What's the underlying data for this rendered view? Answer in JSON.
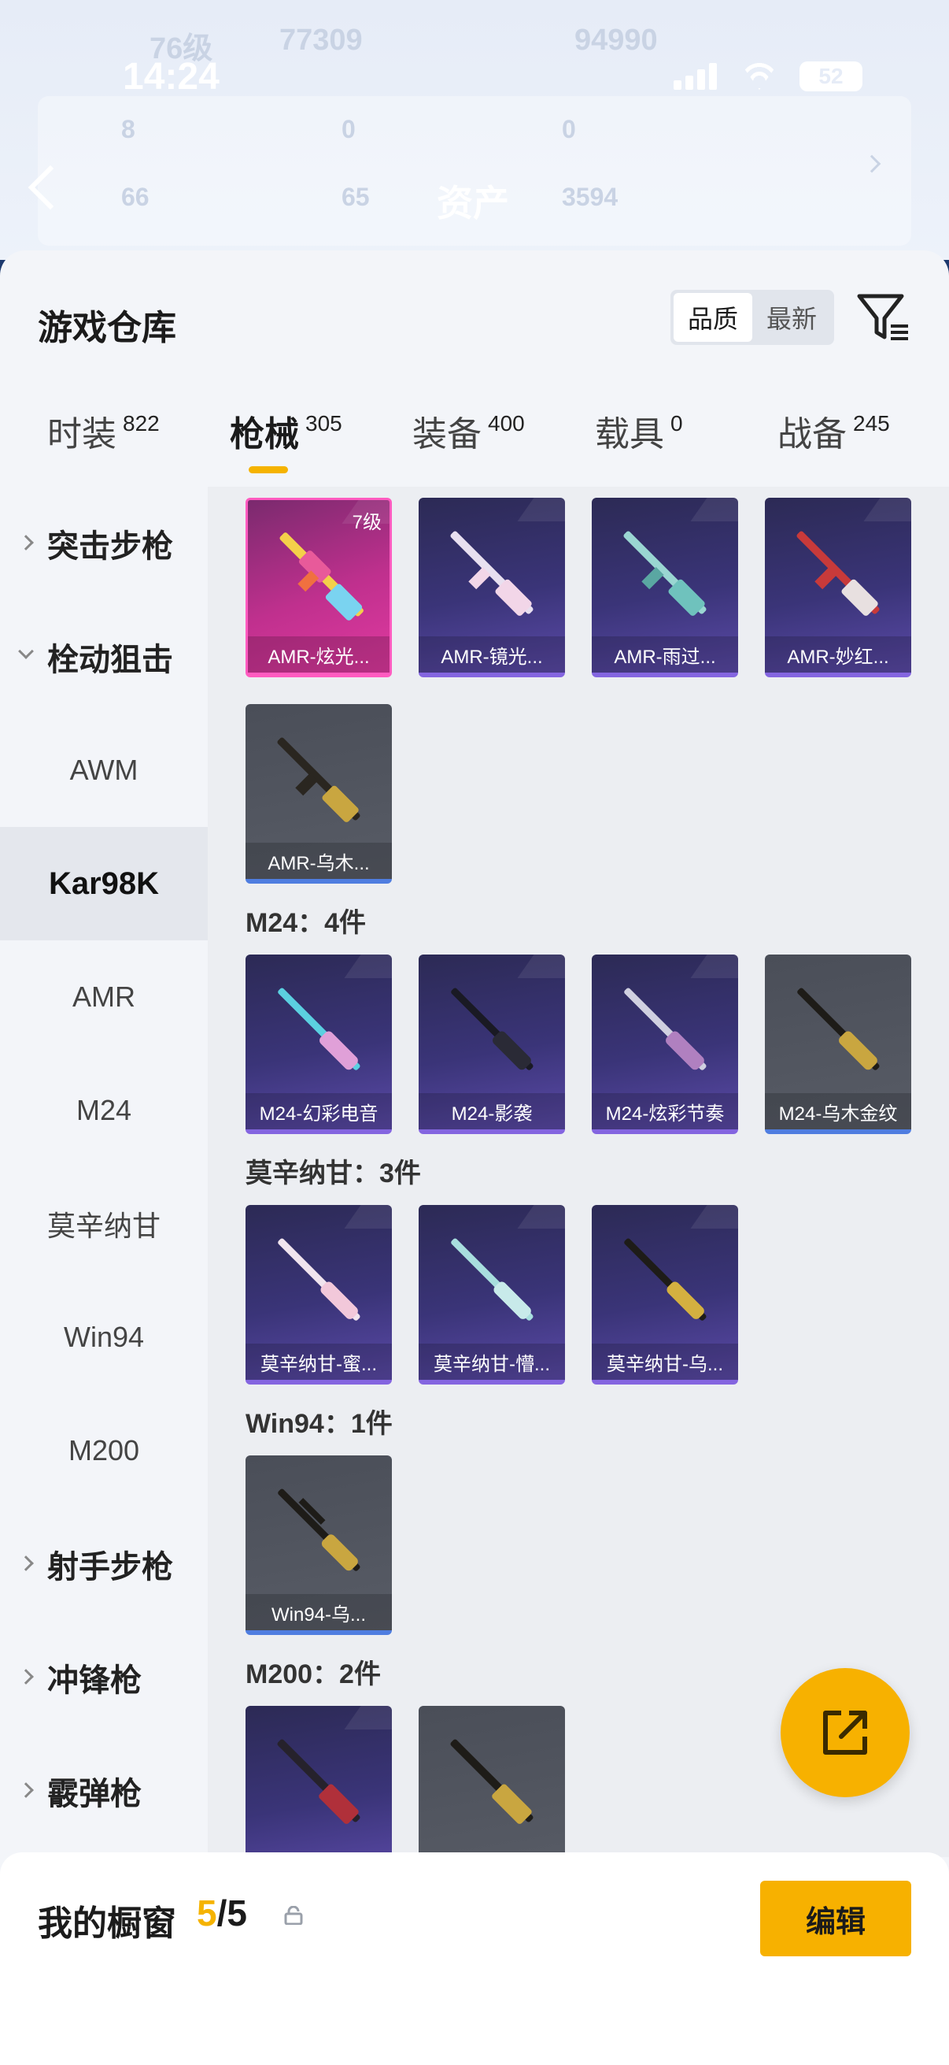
{
  "status_bar": {
    "time": "14:24",
    "battery": "52"
  },
  "background_header": {
    "level": "76级",
    "coins": "77309",
    "points": "94990",
    "stats_row1": [
      "8",
      "0",
      "0"
    ],
    "stats_row2": [
      "66",
      "65",
      "3594"
    ],
    "title": "资产"
  },
  "sheet": {
    "title": "游戏仓库",
    "sort_options": [
      "品质",
      "最新"
    ],
    "active_sort": "品质"
  },
  "tabs": [
    {
      "label": "时装",
      "count": "822"
    },
    {
      "label": "枪械",
      "count": "305"
    },
    {
      "label": "装备",
      "count": "400"
    },
    {
      "label": "载具",
      "count": "0"
    },
    {
      "label": "战备",
      "count": "245"
    }
  ],
  "sidebar": {
    "items": [
      {
        "label": "突击步枪",
        "type": "group"
      },
      {
        "label": "栓动狙击",
        "type": "group-open"
      },
      {
        "label": "AWM",
        "type": "sub"
      },
      {
        "label": "Kar98K",
        "type": "sub-selected"
      },
      {
        "label": "AMR",
        "type": "sub"
      },
      {
        "label": "M24",
        "type": "sub"
      },
      {
        "label": "莫辛纳甘",
        "type": "sub"
      },
      {
        "label": "Win94",
        "type": "sub"
      },
      {
        "label": "M200",
        "type": "sub"
      },
      {
        "label": "射手步枪",
        "type": "group"
      },
      {
        "label": "冲锋枪",
        "type": "group"
      },
      {
        "label": "霰弹枪",
        "type": "group"
      }
    ]
  },
  "content": {
    "amr_cards": [
      {
        "name": "AMR-炫光...",
        "level": "7级",
        "style": "pink"
      },
      {
        "name": "AMR-镜光...",
        "style": "purple"
      },
      {
        "name": "AMR-雨过...",
        "style": "purple"
      },
      {
        "name": "AMR-妙红...",
        "style": "purple"
      },
      {
        "name": "AMR-乌木...",
        "style": "gray"
      }
    ],
    "m24_title": "M24：4件",
    "m24_cards": [
      {
        "name": "M24-幻彩电音",
        "style": "purple"
      },
      {
        "name": "M24-影袭",
        "style": "purple"
      },
      {
        "name": "M24-炫彩节奏",
        "style": "purple"
      },
      {
        "name": "M24-乌木金纹",
        "style": "gray"
      }
    ],
    "mosin_title": "莫辛纳甘：3件",
    "mosin_cards": [
      {
        "name": "莫辛纳甘-蜜...",
        "style": "purple"
      },
      {
        "name": "莫辛纳甘-懵...",
        "style": "purple"
      },
      {
        "name": "莫辛纳甘-乌...",
        "style": "purple"
      }
    ],
    "win94_title": "Win94：1件",
    "win94_cards": [
      {
        "name": "Win94-乌...",
        "style": "gray"
      }
    ],
    "m200_title": "M200：2件",
    "m200_cards": [
      {
        "name": "",
        "style": "purple"
      },
      {
        "name": "",
        "style": "gray"
      }
    ]
  },
  "bottom_bar": {
    "title": "我的橱窗",
    "count_current": "5",
    "count_sep_total": "/5",
    "edit_label": "编辑"
  },
  "icons": {
    "filter": "filter-icon",
    "share": "share-external-icon",
    "lock": "lock-icon",
    "back": "back-chevron-icon"
  },
  "colors": {
    "accent": "#f7b100",
    "card_purple": "#3a3478",
    "card_pink": "#c0308e",
    "card_gray": "#585c66"
  }
}
